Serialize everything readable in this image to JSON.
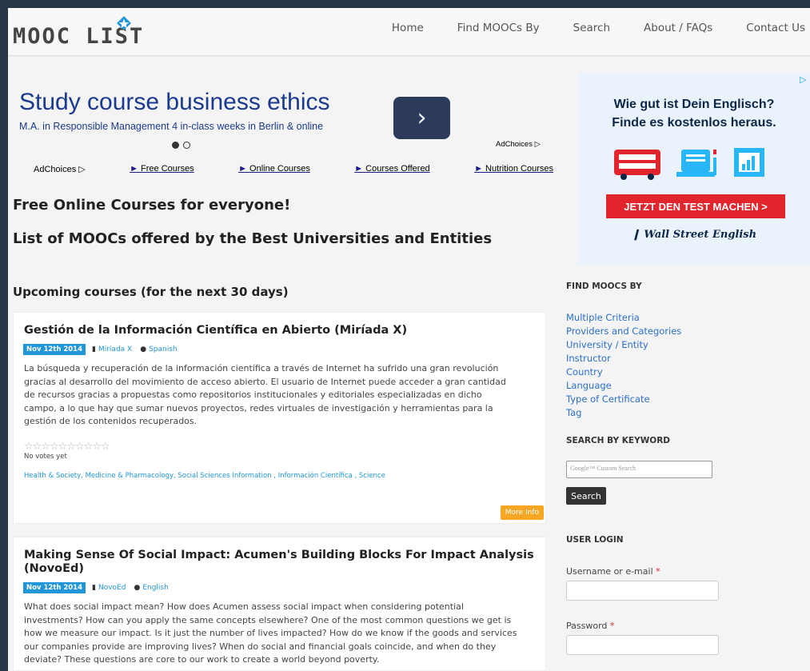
{
  "header": {
    "logo_text": "MOOC LIST",
    "nav": [
      "Home",
      "Find MOOCs By",
      "Search",
      "About / FAQs",
      "Contact Us"
    ]
  },
  "top_ad": {
    "title": "Study course business ethics",
    "subtitle": "M.A. in Responsible Management 4 in-class weeks in Berlin & online",
    "adchoices": "AdChoices",
    "links": [
      "Free Courses",
      "Online Courses",
      "Courses Offered",
      "Nutrition Courses"
    ]
  },
  "main": {
    "heading1": "Free Online Courses for everyone!",
    "heading2": "List of MOOCs offered by the Best Universities and Entities",
    "upcoming": "Upcoming courses (for the next 30 days)"
  },
  "courses": [
    {
      "title": "Gestión de la Información Científica en Abierto (Miríada X)",
      "date": "Nov 12th 2014",
      "provider": "Miríada X",
      "language": "Spanish",
      "desc_lines": [
        "La búsqueda y recuperación de la información científica a través de Internet ha sufrido una gran revolución",
        "gracias al desarrollo del movimiento de acceso abierto. El usuario de Internet puede acceder a gran cantidad",
        "de recursos gracias a propuestas como repositorios institucionales y editoriales especializadas en dicho",
        "campo, a lo que hay que sumar nuevos proyectos, redes virtuales de investigación y herramientas para la",
        "gestión de los contenidos recuperados."
      ],
      "stars": "☆☆☆☆☆☆☆☆☆☆",
      "votes": "No votes yet",
      "tags": "Health & Society, Medicine & Pharmacology, Social Sciences   Information , Información Científica , Science",
      "more": "More Info"
    },
    {
      "title": "Making Sense Of Social Impact: Acumen's Building Blocks For Impact Analysis (NovoEd)",
      "date": "Nov 12th 2014",
      "provider": "NovoEd",
      "language": "English",
      "desc_lines": [
        "What does social impact mean? How does Acumen assess social impact when considering potential",
        "investments? How can you apply the same concepts elsewhere? One of the most common questions we get is",
        "how we measure our impact. Is it just the number of lives impacted? How do we know if the goods and services",
        "our companies provide are improving lives? When do social and financial goals coincide, and when do they",
        "deviate? These questions are core to our work to create a world beyond poverty."
      ]
    }
  ],
  "side_ad": {
    "title_line1": "Wie gut ist Dein Englisch?",
    "title_line2": "Finde es kostenlos heraus.",
    "button": "JETZT DEN TEST MACHEN >",
    "brand": "Wall Street English"
  },
  "sidebar": {
    "find_heading": "FIND MOOCS BY",
    "find_links": [
      "Multiple Criteria",
      "Providers and Categories",
      "University / Entity",
      "Instructor",
      "Country",
      "Language",
      "Type of Certificate",
      "Tag"
    ],
    "search_heading": "SEARCH BY KEYWORD",
    "search_placeholder": "Google™ Custom Search",
    "search_button": "Search",
    "login_heading": "USER LOGIN",
    "username_label": "Username or e-mail",
    "password_label": "Password",
    "required_mark": "*"
  },
  "colors": {
    "accent": "#2196d8",
    "more_button": "#f5a623",
    "ad_red": "#e2242c"
  }
}
